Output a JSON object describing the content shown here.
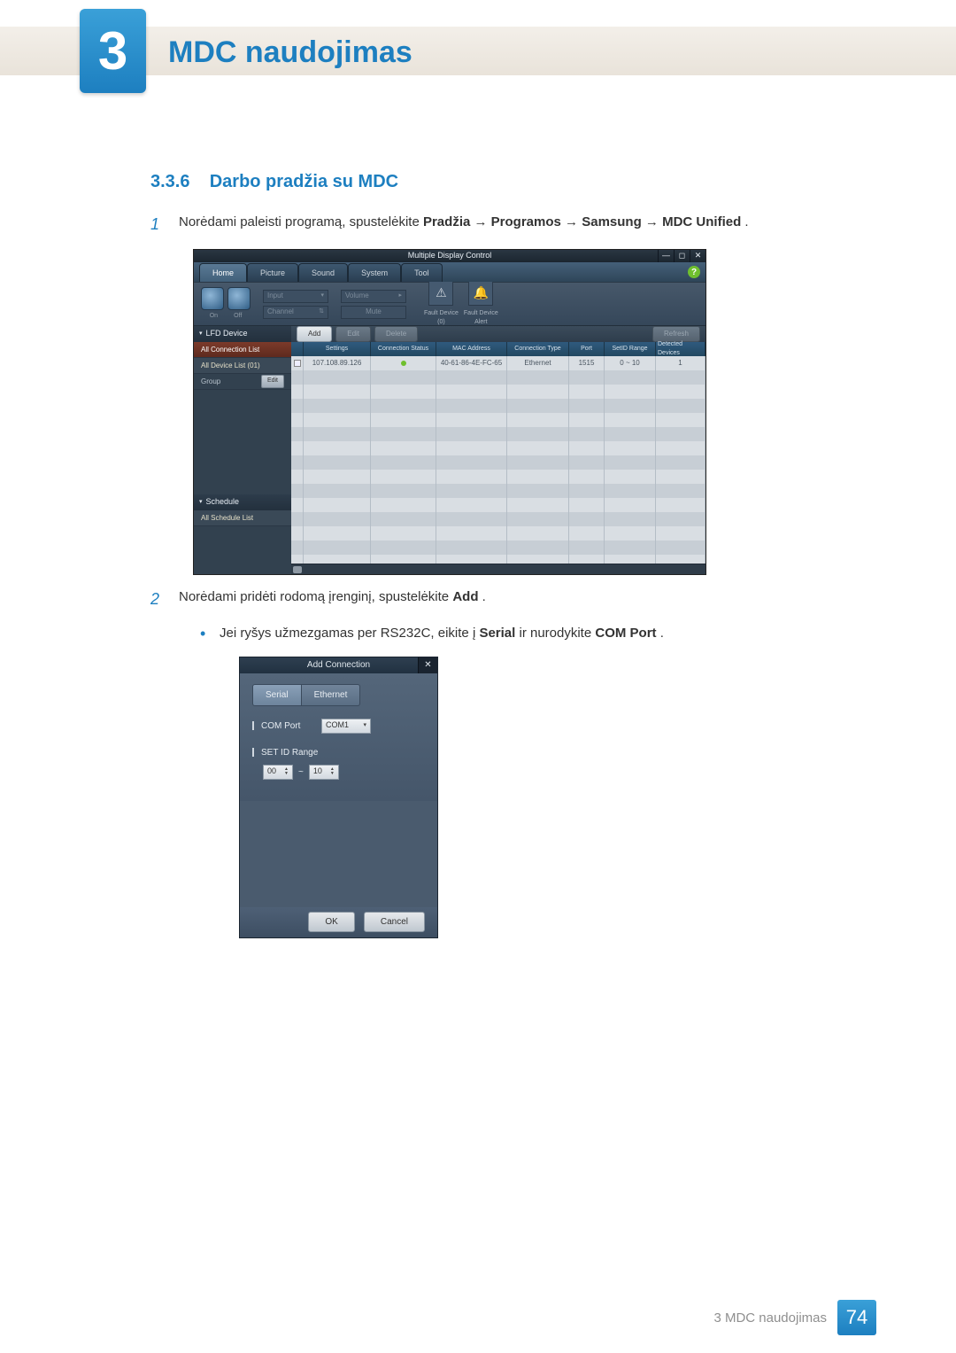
{
  "chapter": {
    "number": "3",
    "title": "MDC naudojimas"
  },
  "section": {
    "number": "3.3.6",
    "title": "Darbo pradžia su MDC"
  },
  "steps": {
    "s1_num": "1",
    "s1_a": "Norėdami paleisti programą, spustelėkite ",
    "s1_b1": "Pradžia",
    "s1_arr1": " → ",
    "s1_b2": "Programos",
    "s1_arr2": " → ",
    "s1_b3": "Samsung",
    "s1_arr3": " → ",
    "s1_b4": "MDC Unified",
    "s1_end": ".",
    "s2_num": "2",
    "s2_a": "Norėdami pridėti rodomą įrenginį, spustelėkite ",
    "s2_b": "Add",
    "s2_end": ".",
    "bullet_a": "Jei ryšys užmezgamas per RS232C, eikite į ",
    "bullet_b1": "Serial",
    "bullet_mid": " ir nurodykite ",
    "bullet_b2": "COM Port",
    "bullet_end": "."
  },
  "mdc": {
    "title": "Multiple Display Control",
    "win": {
      "min": "—",
      "max": "◻",
      "close": "✕"
    },
    "help": "?",
    "tabs": {
      "home": "Home",
      "picture": "Picture",
      "sound": "Sound",
      "system": "System",
      "tool": "Tool"
    },
    "ribbon": {
      "on": "On",
      "off": "Off",
      "input": "Input",
      "channel": "Channel",
      "volume": "Volume",
      "mute": "Mute",
      "fault0_top": "Fault Device",
      "fault0_bot": "(0)",
      "fault1_top": "Fault Device",
      "fault1_bot": "Alert"
    },
    "side": {
      "lfd": "LFD Device",
      "all_conn": "All Connection List",
      "all_dev": "All Device List (01)",
      "group": "Group",
      "edit": "Edit",
      "schedule": "Schedule",
      "all_sched": "All Schedule List"
    },
    "actions": {
      "add": "Add",
      "edit": "Edit",
      "delete": "Delete",
      "refresh": "Refresh"
    },
    "cols": {
      "settings": "Settings",
      "conn": "Connection Status",
      "mac": "MAC Address",
      "ctype": "Connection Type",
      "port": "Port",
      "range": "SetID Range",
      "det": "Detected Devices"
    },
    "row": {
      "settings": "107.108.89.126",
      "mac": "40-61-86-4E-FC-65",
      "ctype": "Ethernet",
      "port": "1515",
      "range": "0 ~ 10",
      "det": "1"
    }
  },
  "dialog": {
    "title": "Add Connection",
    "tabs": {
      "serial": "Serial",
      "ethernet": "Ethernet"
    },
    "com_label": "COM Port",
    "com_value": "COM1",
    "range_label": "SET ID Range",
    "range_from": "00",
    "range_sep": "~",
    "range_to": "10",
    "ok": "OK",
    "cancel": "Cancel"
  },
  "footer": {
    "text": "3 MDC naudojimas",
    "page": "74"
  }
}
